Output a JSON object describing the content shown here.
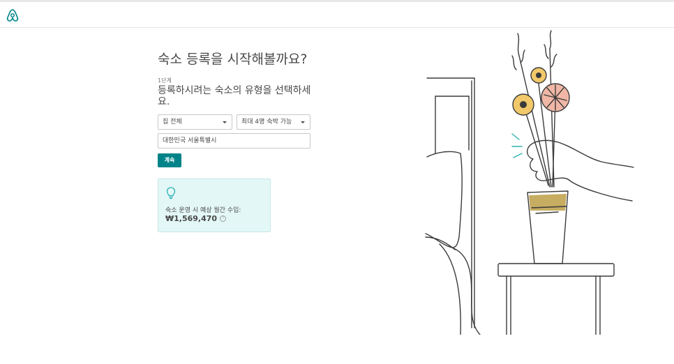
{
  "header": {
    "logo": "airbnb-logo"
  },
  "main": {
    "title": "숙소 등록을 시작해볼까요?",
    "step": "1단계",
    "subtitle": "등록하시려는 숙소의 유형을 선택하세요.",
    "property_type": "집 전체",
    "guests": "최대 4명 숙박 가능",
    "location": "대한민국 서울특별시",
    "continue_label": "계속"
  },
  "estimate": {
    "icon": "lightbulb-icon",
    "label": "숙소 운영 시 예상 월간 수입:",
    "value": "₩1,569,470",
    "info_icon": "?"
  },
  "colors": {
    "accent": "#008489",
    "card_bg": "#e4f7f7",
    "text": "#484848"
  }
}
